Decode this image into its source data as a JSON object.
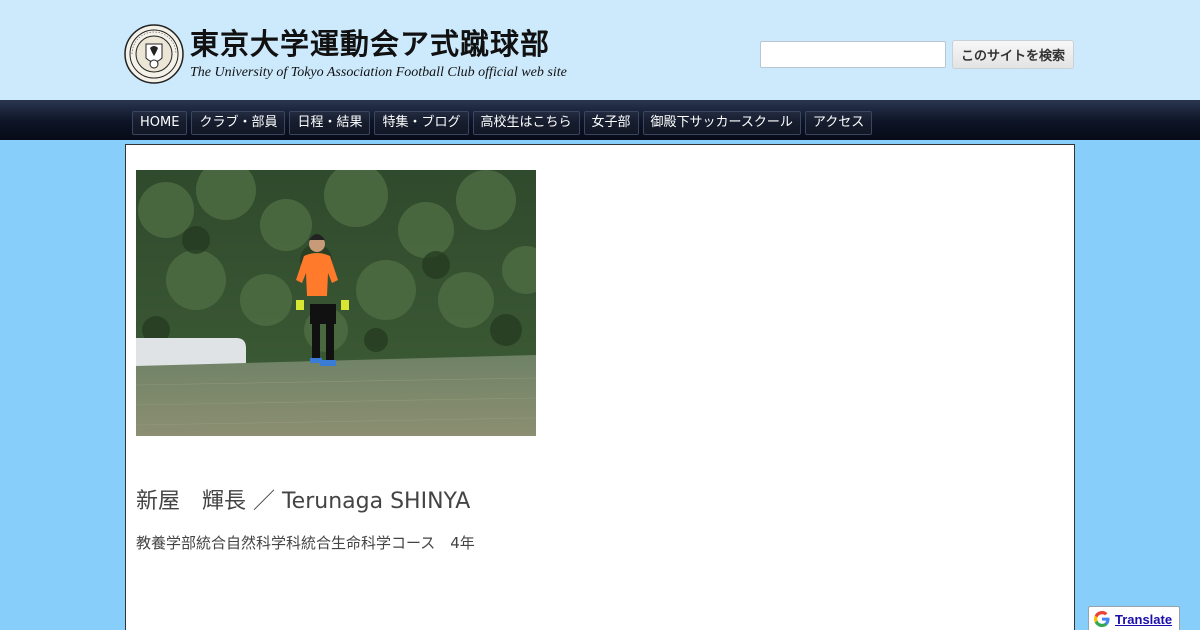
{
  "header": {
    "title": "東京大学運動会ア式蹴球部",
    "subtitle": "The University of Tokyo Association Football Club official web site",
    "search": {
      "value": "",
      "button_label": "このサイトを検索"
    }
  },
  "nav": {
    "items": [
      {
        "label": "HOME"
      },
      {
        "label": "クラブ・部員"
      },
      {
        "label": "日程・結果"
      },
      {
        "label": "特集・ブログ"
      },
      {
        "label": "高校生はこちら"
      },
      {
        "label": "女子部"
      },
      {
        "label": "御殿下サッカースクール"
      },
      {
        "label": "アクセス"
      }
    ]
  },
  "main": {
    "player_name": "新屋　輝長 ／ Terunaga SHINYA",
    "department": "教養学部統合自然科学科統合生命科学コース　4年"
  },
  "translate": {
    "label": "Translate"
  },
  "colors": {
    "page_background": "#87cefa",
    "header_background": "#cdeafd",
    "nav_background": "#0d1426",
    "jersey": "#ff7a2a"
  }
}
